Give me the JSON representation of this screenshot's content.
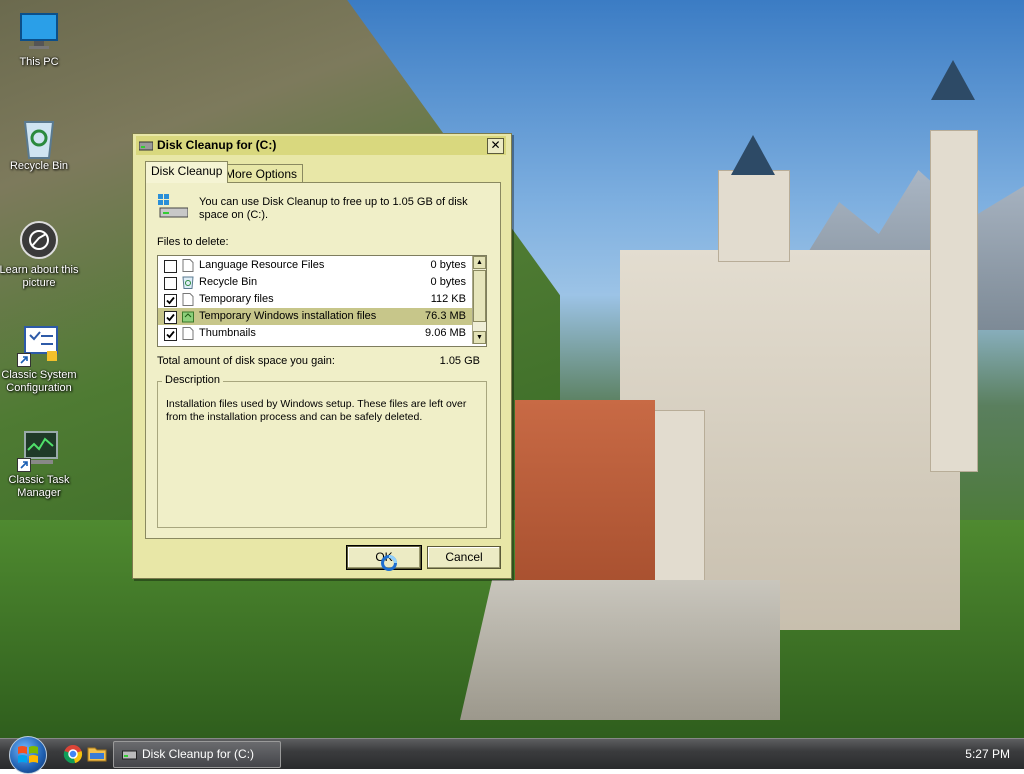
{
  "desktop_icons": [
    {
      "label": "This PC",
      "icon": "monitor-icon"
    },
    {
      "label": "Recycle Bin",
      "icon": "recycle-bin-icon"
    },
    {
      "label": "Learn about this picture",
      "icon": "camera-icon"
    },
    {
      "label": "Classic System Configuration",
      "icon": "system-config-icon"
    },
    {
      "label": "Classic Task Manager",
      "icon": "task-manager-icon"
    }
  ],
  "dialog": {
    "title": "Disk Cleanup for  (C:)",
    "close_glyph": "✕",
    "tabs": [
      {
        "label": "Disk Cleanup",
        "active": true
      },
      {
        "label": "More Options",
        "active": false
      }
    ],
    "intro_text": "You can use Disk Cleanup to free up to 1.05 GB of disk space on  (C:).",
    "files_label": "Files to delete:",
    "files": [
      {
        "name": "Language Resource Files",
        "size": "0 bytes",
        "checked": false,
        "selected": false,
        "icon": "file-icon"
      },
      {
        "name": "Recycle Bin",
        "size": "0 bytes",
        "checked": false,
        "selected": false,
        "icon": "recycle-bin-icon"
      },
      {
        "name": "Temporary files",
        "size": "112 KB",
        "checked": true,
        "selected": false,
        "icon": "file-icon"
      },
      {
        "name": "Temporary Windows installation files",
        "size": "76.3 MB",
        "checked": true,
        "selected": true,
        "icon": "windows-setup-icon"
      },
      {
        "name": "Thumbnails",
        "size": "9.06 MB",
        "checked": true,
        "selected": false,
        "icon": "file-icon"
      }
    ],
    "total_label": "Total amount of disk space you gain:",
    "total_value": "1.05 GB",
    "description_legend": "Description",
    "description_text": "Installation files used by Windows setup.  These files are left over from the installation process and can be safely deleted.",
    "ok_label": "OK",
    "cancel_label": "Cancel"
  },
  "taskbar": {
    "task_label": "Disk Cleanup for  (C:)",
    "clock": "5:27 PM",
    "pinned": [
      "chrome-icon",
      "folder-icon"
    ]
  },
  "colors": {
    "dialog_bg": "#e8e7a7",
    "titlebar_bg": "#d9d87e",
    "selected_row": "#c7c68a",
    "taskbar_bg": "#3b3c3e"
  }
}
